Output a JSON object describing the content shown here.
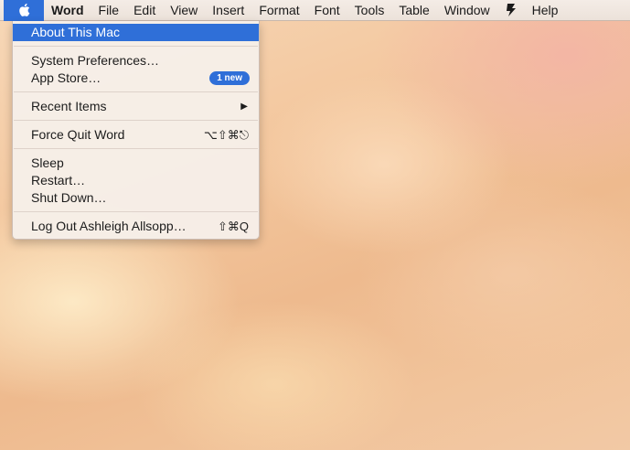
{
  "menubar": {
    "app_name": "Word",
    "items": [
      "File",
      "Edit",
      "View",
      "Insert",
      "Format",
      "Font",
      "Tools",
      "Table",
      "Window",
      "Help"
    ]
  },
  "apple_menu": {
    "about": "About This Mac",
    "system_preferences": "System Preferences…",
    "app_store": "App Store…",
    "app_store_badge": "1 new",
    "recent_items": "Recent Items",
    "force_quit": "Force Quit Word",
    "force_quit_shortcut": "⌥⇧⌘⎋",
    "sleep": "Sleep",
    "restart": "Restart…",
    "shut_down": "Shut Down…",
    "log_out": "Log Out Ashleigh Allsopp…",
    "log_out_shortcut": "⇧⌘Q"
  },
  "colors": {
    "highlight": "#2f6fd8"
  }
}
